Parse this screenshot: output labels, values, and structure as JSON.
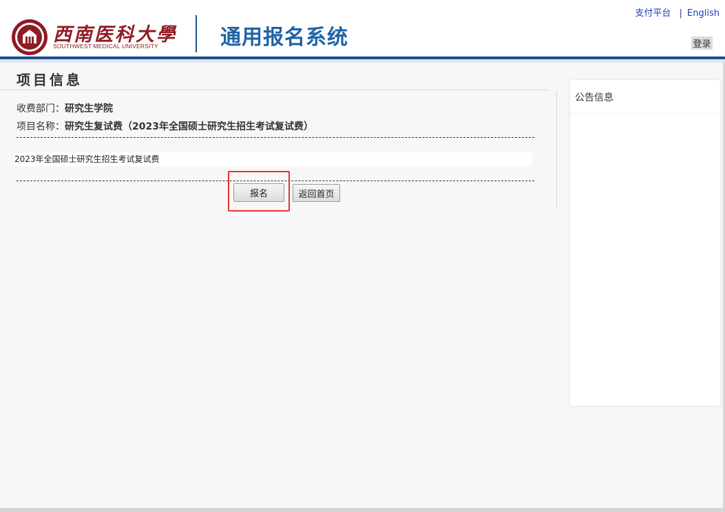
{
  "header": {
    "logo_cn": "西南医科大學",
    "logo_en": "SOUTHWEST MEDICAL UNIVERSITY",
    "system_title": "通用报名系统",
    "links": {
      "pay_platform": "支付平台",
      "separator": "|",
      "english": "English"
    },
    "login_label": "登录"
  },
  "main": {
    "section_title": "项目信息",
    "department": {
      "label": "收费部门：",
      "value": "研究生学院"
    },
    "project": {
      "label": "项目名称：",
      "value": "研究生复试费（2023年全国硕士研究生招生考试复试费）"
    },
    "description": "2023年全国硕士研究生招生考试复试费",
    "buttons": {
      "register": "报名",
      "back_home": "返回首页"
    }
  },
  "sidebar": {
    "title": "公告信息"
  },
  "colors": {
    "brand_blue": "#1f63a6",
    "brand_red": "#8f1b24",
    "highlight_red": "#e8312b",
    "link_blue": "#1a3fbd"
  }
}
